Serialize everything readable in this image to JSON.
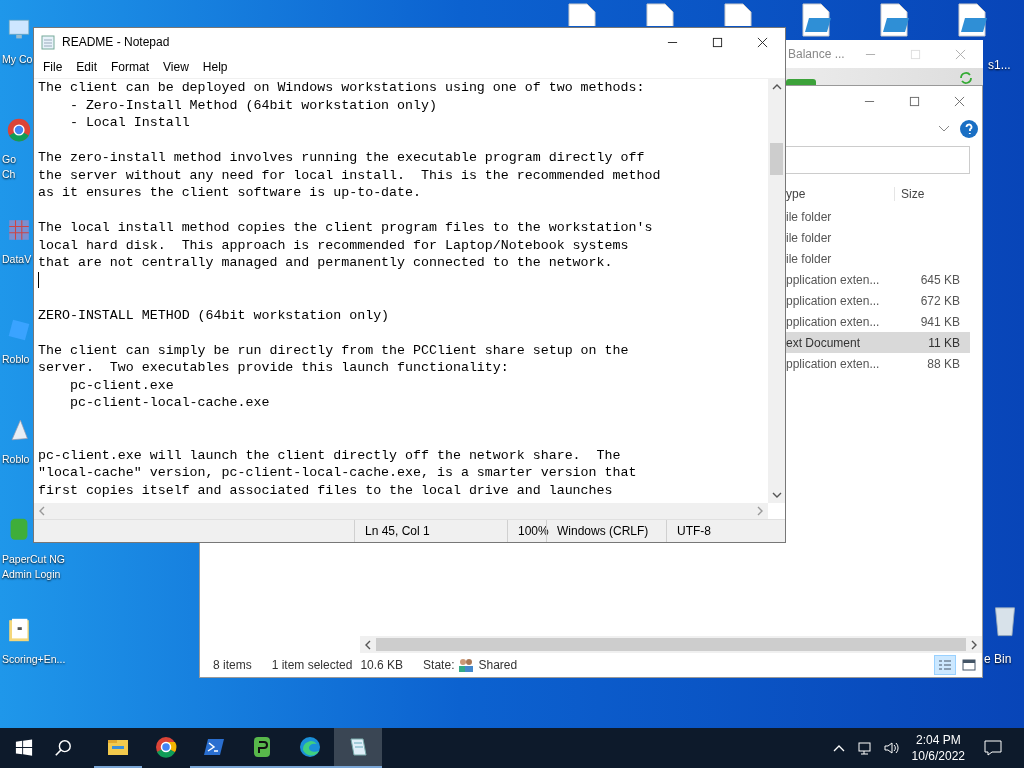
{
  "desktop_icons": [
    {
      "kind": "computer",
      "label": [
        "My Co"
      ]
    },
    {
      "kind": "chrome",
      "label": [
        "Go",
        "Ch"
      ]
    },
    {
      "kind": "grid",
      "label": [
        "DataV"
      ]
    },
    {
      "kind": "roblox",
      "label": [
        "Roblo"
      ]
    },
    {
      "kind": "studio",
      "label": [
        "Roblo"
      ]
    },
    {
      "kind": "papercut",
      "label": [
        "PaperCut NG",
        "Admin Login"
      ]
    },
    {
      "kind": "folder",
      "label": [
        "Scoring+En..."
      ]
    }
  ],
  "top_icons": [
    {
      "kind": "file"
    },
    {
      "kind": "file"
    },
    {
      "kind": "file"
    },
    {
      "kind": "script"
    },
    {
      "kind": "script"
    },
    {
      "kind": "script",
      "label": "s1..."
    }
  ],
  "recycle_bin": {
    "label": "e Bin"
  },
  "balance_window": {
    "title": "Balance ..."
  },
  "explorer": {
    "columns": [
      "ype",
      "Size"
    ],
    "rows": [
      {
        "type": "ile folder",
        "size": "",
        "selected": false
      },
      {
        "type": "ile folder",
        "size": "",
        "selected": false
      },
      {
        "type": "ile folder",
        "size": "",
        "selected": false
      },
      {
        "type": "pplication exten...",
        "size": "645 KB",
        "selected": false
      },
      {
        "type": "pplication exten...",
        "size": "672 KB",
        "selected": false
      },
      {
        "type": "pplication exten...",
        "size": "941 KB",
        "selected": false
      },
      {
        "type": "ext Document",
        "size": "11 KB",
        "selected": true
      },
      {
        "type": "pplication exten...",
        "size": "88 KB",
        "selected": false
      }
    ],
    "status": {
      "count": "8 items",
      "selection": "1 item selected",
      "size": "10.6 KB",
      "state_label": "State:",
      "state_value": "Shared"
    },
    "views": [
      {
        "kind": "details",
        "selected": true
      },
      {
        "kind": "large",
        "selected": false
      }
    ]
  },
  "notepad": {
    "title": "README - Notepad",
    "menu": [
      "File",
      "Edit",
      "Format",
      "View",
      "Help"
    ],
    "lines": [
      {
        "kind": "text",
        "text": "The client can be deployed on Windows workstations using one of two methods:"
      },
      {
        "kind": "text",
        "text": "    - Zero-Install Method (64bit workstation only)"
      },
      {
        "kind": "text",
        "text": "    - Local Install"
      },
      {
        "kind": "blank"
      },
      {
        "kind": "text",
        "text": "The zero-install method involves running the executable program directly off"
      },
      {
        "kind": "text",
        "text": "the server without any need for local install.  This is the recommended method"
      },
      {
        "kind": "text",
        "text": "as it ensures the client software is up-to-date."
      },
      {
        "kind": "blank"
      },
      {
        "kind": "text",
        "text": "The local install method copies the client program files to the workstation's"
      },
      {
        "kind": "text",
        "text": "local hard disk.  This approach is recommended for Laptop/Notebook systems"
      },
      {
        "kind": "text",
        "text": "that are not centrally managed and permanently connected to the network."
      },
      {
        "kind": "cursor"
      },
      {
        "kind": "blank"
      },
      {
        "kind": "text",
        "text": "ZERO-INSTALL METHOD (64bit workstation only)"
      },
      {
        "kind": "blank"
      },
      {
        "kind": "text",
        "text": "The client can simply be run directly from the PCClient share setup on the"
      },
      {
        "kind": "text",
        "text": "server.  Two executables provide this launch functionality:"
      },
      {
        "kind": "text",
        "text": "    pc-client.exe"
      },
      {
        "kind": "text",
        "text": "    pc-client-local-cache.exe"
      },
      {
        "kind": "blank"
      },
      {
        "kind": "blank"
      },
      {
        "kind": "text",
        "text": "pc-client.exe will launch the client directly off the network share.  The"
      },
      {
        "kind": "text",
        "text": "\"local-cache\" version, pc-client-local-cache.exe, is a smarter version that"
      },
      {
        "kind": "text",
        "text": "first copies itself and associated files to the local drive and launches"
      }
    ],
    "status": {
      "position": "Ln 45, Col 1",
      "zoom": "100%",
      "line_endings": "Windows (CRLF)",
      "encoding": "UTF-8"
    }
  },
  "taskbar": {
    "apps": [
      {
        "kind": "explorer",
        "open": true,
        "active": false
      },
      {
        "kind": "chrome",
        "open": false,
        "active": false
      },
      {
        "kind": "powershell",
        "open": true,
        "active": false
      },
      {
        "kind": "papercut",
        "open": true,
        "active": false
      },
      {
        "kind": "edge",
        "open": true,
        "active": false
      },
      {
        "kind": "notepad",
        "open": true,
        "active": true
      }
    ],
    "time": "2:04 PM",
    "date": "10/6/2022"
  }
}
